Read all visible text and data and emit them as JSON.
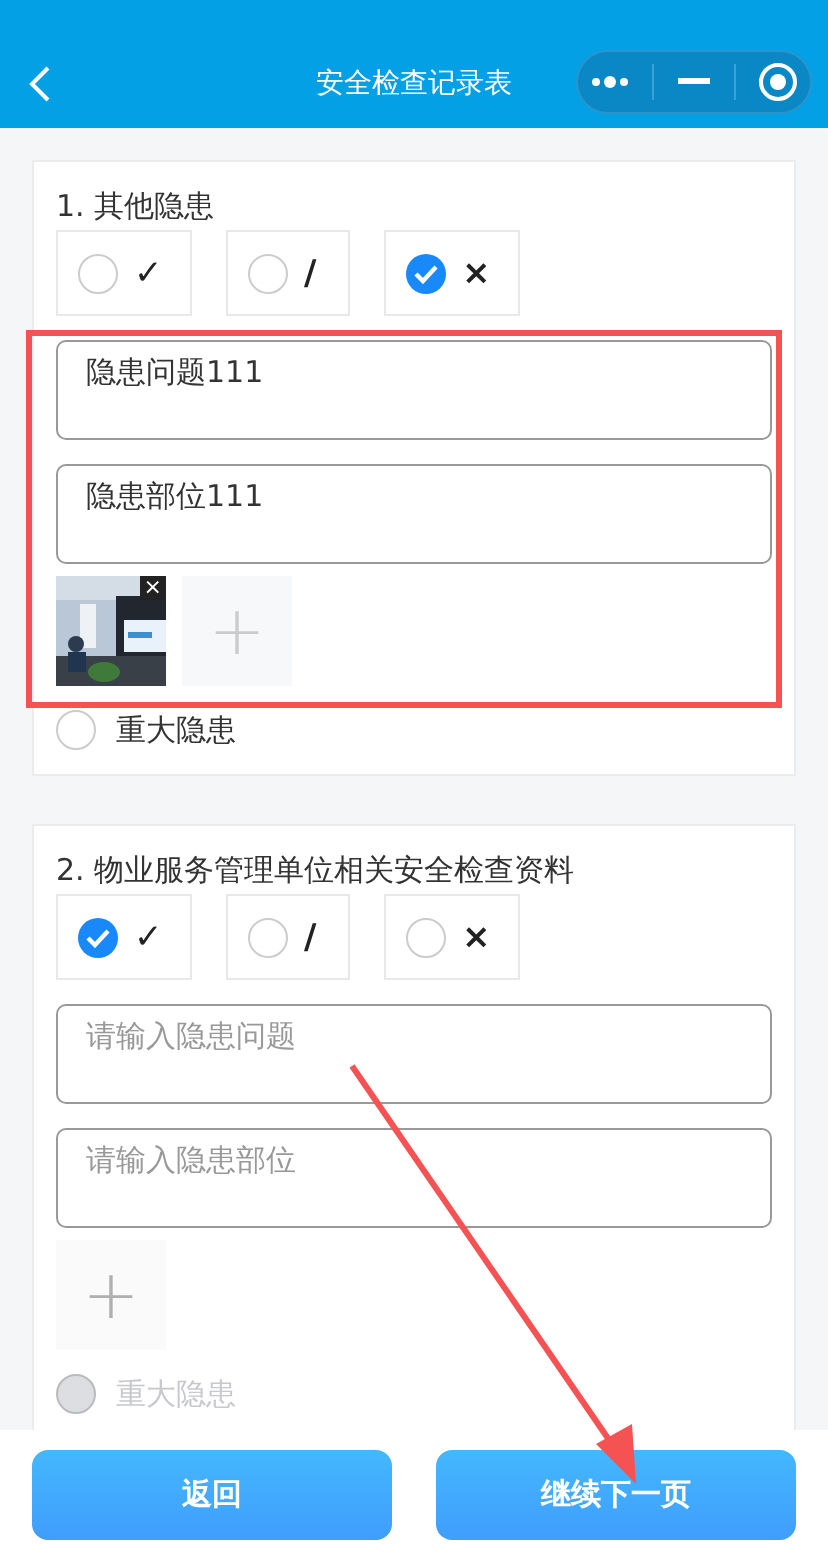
{
  "nav": {
    "title": "安全检查记录表"
  },
  "sections": [
    {
      "title": "1. 其他隐患",
      "options": [
        {
          "label": "✓",
          "selected": false
        },
        {
          "label": "/",
          "selected": false
        },
        {
          "label": "×",
          "selected": true
        }
      ],
      "fields": [
        {
          "value": "隐患问题111"
        },
        {
          "value": "隐患部位111"
        }
      ],
      "photos": [
        {
          "kind": "picture",
          "remove": "×"
        }
      ],
      "upload": {
        "icon": "+",
        "disabled": false
      },
      "major": {
        "label": "重大隐患",
        "checked": false,
        "disabled": false
      }
    },
    {
      "title": "2. 物业服务管理单位相关安全检查资料",
      "options": [
        {
          "label": "✓",
          "selected": true
        },
        {
          "label": "/",
          "selected": false
        },
        {
          "label": "×",
          "selected": false
        }
      ],
      "fields": [
        {
          "placeholder": "请输入隐患问题"
        },
        {
          "placeholder": "请输入隐患部位"
        }
      ],
      "upload": {
        "icon": "+",
        "disabled": true
      },
      "major": {
        "label": "重大隐患",
        "checked": false,
        "disabled": true
      }
    }
  ],
  "buttons": [
    {
      "label": "返回"
    },
    {
      "label": "继续下一页"
    }
  ]
}
